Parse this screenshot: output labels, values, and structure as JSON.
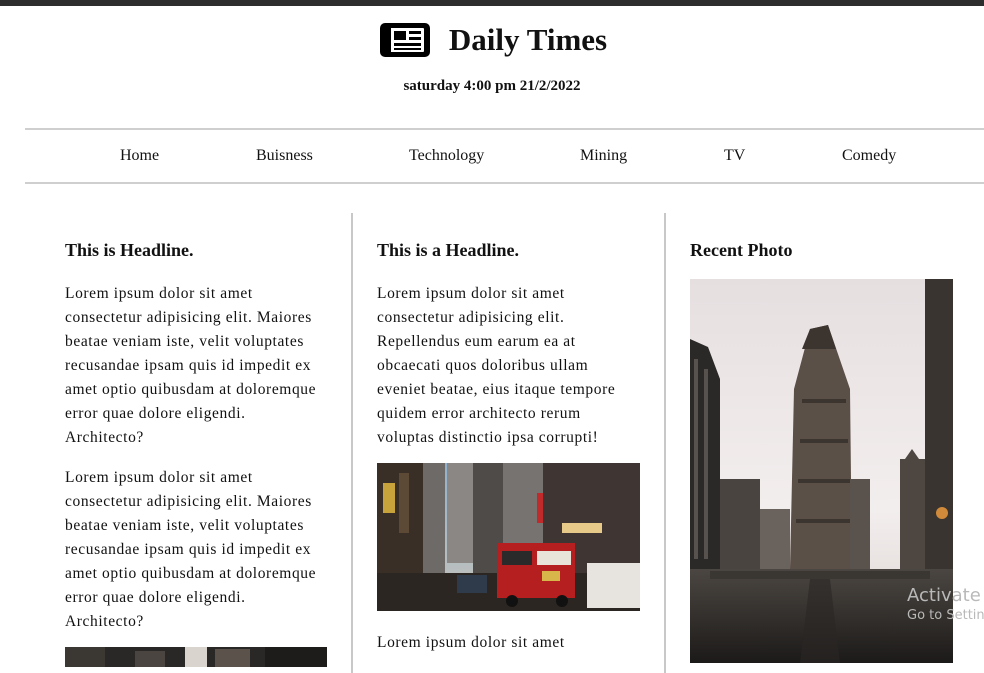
{
  "site": {
    "title": "Daily Times",
    "icon": "newspaper-icon",
    "dateline": "saturday 4:00 pm 21/2/2022"
  },
  "nav": {
    "items": [
      {
        "label": "Home"
      },
      {
        "label": "Buisness"
      },
      {
        "label": "Technology"
      },
      {
        "label": "Mining"
      },
      {
        "label": "TV"
      },
      {
        "label": "Comedy"
      }
    ]
  },
  "columns": {
    "left": {
      "headline": "This is Headline.",
      "paragraphs": [
        "Lorem ipsum dolor sit amet consectetur adipisicing elit. Maiores beatae veniam iste, velit voluptates recusandae ipsam quis id impedit ex amet optio quibusdam at doloremque error quae dolore eligendi. Architecto?",
        "Lorem ipsum dolor sit amet consectetur adipisicing elit. Maiores beatae veniam iste, velit voluptates recusandae ipsam quis id impedit ex amet optio quibusdam at doloremque error quae dolore eligendi. Architecto?"
      ]
    },
    "middle": {
      "headline": "This is a Headline.",
      "paragraphs": [
        "Lorem ipsum dolor sit amet consectetur adipisicing elit. Repellendus eum earum ea at obcaecati quos doloribus ullam eveniet beatae, eius itaque tempore quidem error architecto rerum voluptas distinctio ipsa corrupti!",
        "Lorem ipsum dolor sit amet"
      ]
    },
    "right": {
      "headline": "Recent Photo"
    }
  },
  "watermark": {
    "line1": "Activate",
    "line2": "Go to Settin"
  },
  "colors": {
    "topbar": "#2d2d2d",
    "divider": "#c8c8c8",
    "text": "#111111"
  }
}
